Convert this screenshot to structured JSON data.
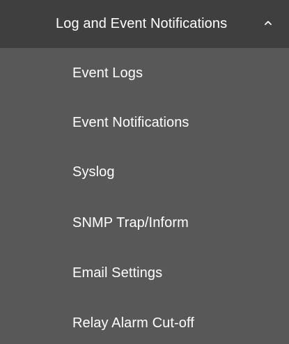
{
  "menu": {
    "header_label": "Log and Event Notifications",
    "header_icon": "chevron-up-icon",
    "items": [
      {
        "label": "Event Logs"
      },
      {
        "label": "Event Notifications"
      },
      {
        "label": "Syslog"
      },
      {
        "label": "SNMP Trap/Inform"
      },
      {
        "label": "Email Settings"
      },
      {
        "label": "Relay Alarm Cut-off"
      }
    ]
  },
  "colors": {
    "header_background": "#3f3f3f",
    "menu_background": "#585858",
    "text": "#ffffff"
  }
}
